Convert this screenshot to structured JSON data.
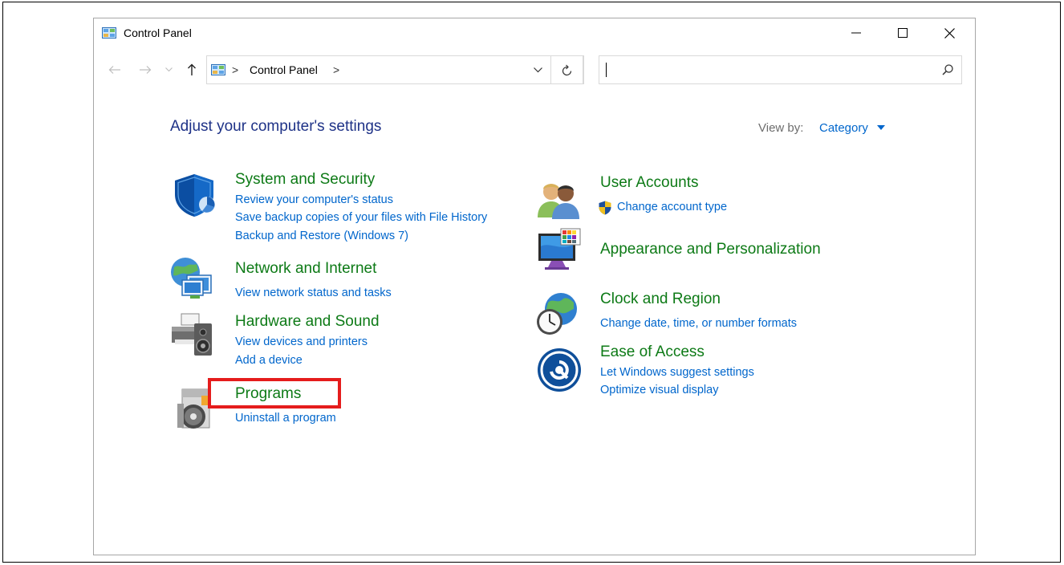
{
  "window": {
    "title": "Control Panel"
  },
  "address": {
    "path_label": "Control Panel",
    "separator": ">"
  },
  "content": {
    "heading": "Adjust your computer's settings",
    "view_by_label": "View by:",
    "view_by_value": "Category"
  },
  "categories": {
    "system_security": {
      "title": "System and Security",
      "links": [
        "Review your computer's status",
        "Save backup copies of your files with File History",
        "Backup and Restore (Windows 7)"
      ]
    },
    "network": {
      "title": "Network and Internet",
      "links": [
        "View network status and tasks"
      ]
    },
    "hardware": {
      "title": "Hardware and Sound",
      "links": [
        "View devices and printers",
        "Add a device"
      ]
    },
    "programs": {
      "title": "Programs",
      "links": [
        "Uninstall a program"
      ]
    },
    "user_accounts": {
      "title": "User Accounts",
      "links": [
        "Change account type"
      ]
    },
    "appearance": {
      "title": "Appearance and Personalization",
      "links": []
    },
    "clock": {
      "title": "Clock and Region",
      "links": [
        "Change date, time, or number formats"
      ]
    },
    "ease": {
      "title": "Ease of Access",
      "links": [
        "Let Windows suggest settings",
        "Optimize visual display"
      ]
    }
  },
  "colors": {
    "category_title": "#0d7a16",
    "link": "#0066cc",
    "heading": "#1e3287",
    "highlight": "#e51c1c"
  },
  "icons": {
    "system_security": "shield-icon",
    "network": "network-globe-icon",
    "hardware": "printer-speaker-icon",
    "programs": "programs-disc-icon",
    "user_accounts": "users-icon",
    "appearance": "monitor-palette-icon",
    "clock": "clock-globe-icon",
    "ease": "ease-of-access-icon"
  }
}
